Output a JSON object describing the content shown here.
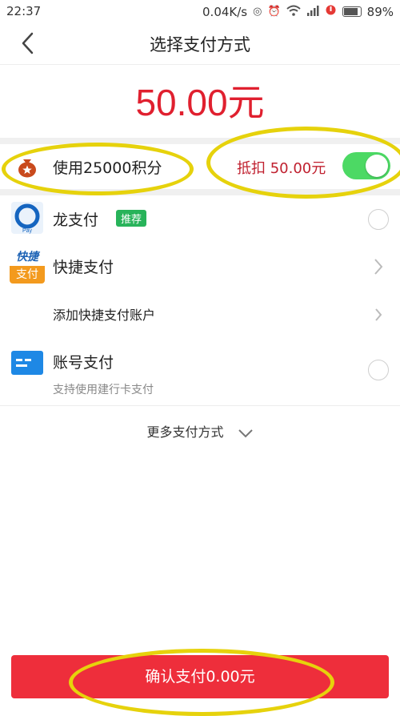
{
  "status_bar": {
    "time": "22:37",
    "net_speed": "0.04K/s",
    "battery": "89%"
  },
  "header": {
    "back_icon": "chevron-left-icon",
    "title": "选择支付方式"
  },
  "amount": "50.00元",
  "points": {
    "label": "使用25000积分",
    "deduct_label": "抵扣 50.00元",
    "toggle_on": true,
    "toggle_color": "#4cd964"
  },
  "payment_methods": [
    {
      "name": "龙支付",
      "badge": "推荐",
      "icon": "long-pay-icon",
      "control": "radio"
    },
    {
      "name": "快捷支付",
      "icon": "quick-pay-icon",
      "icon_text_top": "快捷",
      "icon_text_bottom": "支付",
      "control": "chevron"
    },
    {
      "name": "添加快捷支付账户",
      "control": "chevron"
    },
    {
      "name": "账号支付",
      "sub": "支持使用建行卡支付",
      "icon": "card-icon",
      "control": "radio"
    }
  ],
  "more": "更多支付方式",
  "confirm_button": "确认支付0.00元",
  "accent_color": "#e0202f"
}
